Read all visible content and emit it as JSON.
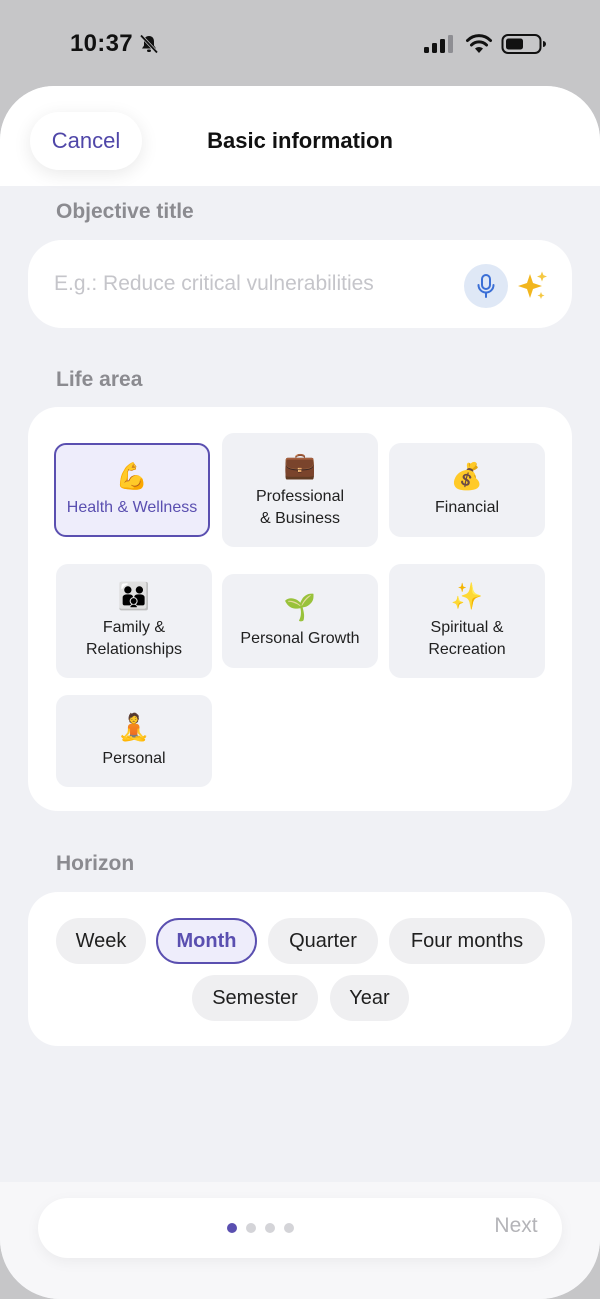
{
  "status_bar": {
    "time": "10:37",
    "icons": [
      "bell-slash-icon",
      "cellular-signal-icon",
      "wifi-icon",
      "battery-icon"
    ]
  },
  "header": {
    "cancel_label": "Cancel",
    "title": "Basic information"
  },
  "objective": {
    "label": "Objective title",
    "placeholder": "E.g.: Reduce critical vulnerabilities",
    "value": "",
    "icons": [
      "microphone-icon",
      "sparkles-icon"
    ]
  },
  "life_area": {
    "label": "Life area",
    "items": [
      {
        "label": "Health & Wellness",
        "emoji": "💪",
        "selected": true
      },
      {
        "label": "Professional\n& Business",
        "emoji": "💼",
        "selected": false
      },
      {
        "label": "Financial",
        "emoji": "💰",
        "selected": false
      },
      {
        "label": "Family &\nRelationships",
        "emoji": "🧑‍🧑‍🧒",
        "selected": false
      },
      {
        "label": "Personal Growth",
        "emoji": "🌱",
        "selected": false
      },
      {
        "label": "Spiritual &\nRecreation",
        "emoji": "✨",
        "selected": false
      },
      {
        "label": "Personal",
        "emoji": "🧘",
        "selected": false
      }
    ]
  },
  "horizon": {
    "label": "Horizon",
    "options": [
      {
        "label": "Week",
        "selected": false
      },
      {
        "label": "Month",
        "selected": true
      },
      {
        "label": "Quarter",
        "selected": false
      },
      {
        "label": "Four months",
        "selected": false
      },
      {
        "label": "Semester",
        "selected": false
      },
      {
        "label": "Year",
        "selected": false
      }
    ]
  },
  "footer": {
    "step": 1,
    "steps": 4,
    "next_label": "Next"
  },
  "colors": {
    "accent": "#5a4fb0",
    "cancel_text": "#4f46a8",
    "background": "#f0f1f5"
  }
}
